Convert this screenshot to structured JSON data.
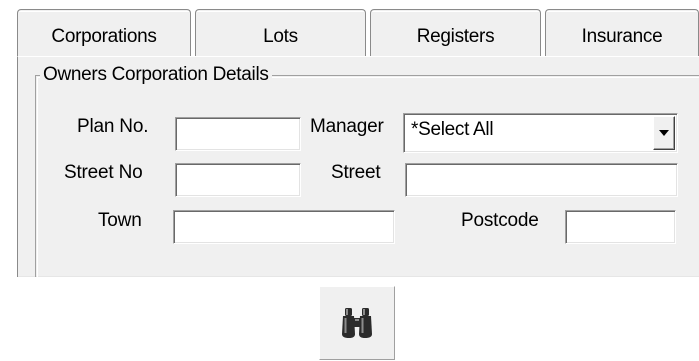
{
  "tabs": [
    {
      "label": "Corporations"
    },
    {
      "label": "Lots"
    },
    {
      "label": "Registers"
    },
    {
      "label": "Insurance"
    }
  ],
  "group": {
    "title": "Owners Corporation Details"
  },
  "fields": {
    "plan_no": {
      "label": "Plan No.",
      "value": ""
    },
    "manager": {
      "label": "Manager",
      "value": "*Select All"
    },
    "street_no": {
      "label": "Street No",
      "value": ""
    },
    "street": {
      "label": "Street",
      "value": ""
    },
    "town": {
      "label": "Town",
      "value": ""
    },
    "postcode": {
      "label": "Postcode",
      "value": ""
    }
  },
  "icons": {
    "search": "binoculars-icon",
    "dropdown": "chevron-down-icon"
  },
  "colors": {
    "panel": "#f0f0f0",
    "border": "#8a8a8a",
    "icon": "#2b2b2b"
  }
}
